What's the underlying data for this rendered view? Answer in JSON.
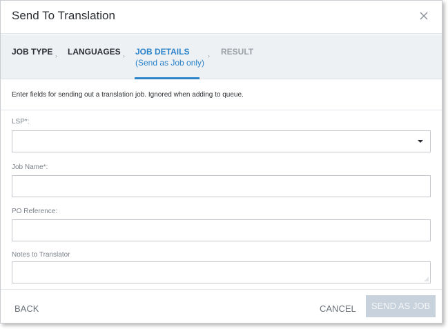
{
  "dialog": {
    "title": "Send To Translation",
    "close_icon": "close-icon"
  },
  "steps": [
    {
      "label": "JOB TYPE",
      "sub": "",
      "state": "done"
    },
    {
      "label": "LANGUAGES",
      "sub": "",
      "state": "done"
    },
    {
      "label": "JOB DETAILS",
      "sub": "(Send as Job only)",
      "state": "active"
    },
    {
      "label": "RESULT",
      "sub": "",
      "state": "disabled"
    }
  ],
  "intro_text": "Enter fields for sending out a translation job. Ignored when adding to queue.",
  "form": {
    "lsp_label": "LSP*:",
    "lsp_value": "",
    "job_name_label": "Job Name*:",
    "job_name_value": "",
    "po_reference_label": "PO Reference:",
    "po_reference_value": "",
    "notes_label": "Notes to Translator",
    "notes_value": ""
  },
  "footer": {
    "back_label": "BACK",
    "cancel_label": "CANCEL",
    "send_label": "SEND AS JOB"
  },
  "colors": {
    "accent": "#2a82c9",
    "disabled_button": "#c8d2dc",
    "steps_background": "#eef1f4"
  }
}
